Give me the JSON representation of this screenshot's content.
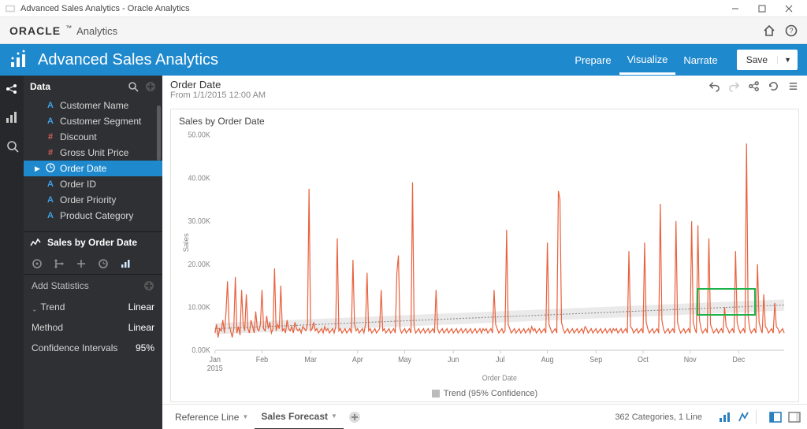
{
  "window": {
    "title": "Advanced Sales Analytics - Oracle Analytics"
  },
  "brand": {
    "oracle": "ORACLE",
    "tm": "™",
    "product": "Analytics"
  },
  "workbook": {
    "title": "Advanced Sales Analytics",
    "tabs": {
      "prepare": "Prepare",
      "visualize": "Visualize",
      "narrate": "Narrate"
    },
    "save_label": "Save"
  },
  "sidebar": {
    "data_header": "Data",
    "fields": [
      {
        "type": "A",
        "label": "Customer Name"
      },
      {
        "type": "A",
        "label": "Customer Segment"
      },
      {
        "type": "hash",
        "label": "Discount"
      },
      {
        "type": "hash",
        "label": "Gross Unit Price"
      },
      {
        "type": "clock",
        "label": "Order Date",
        "selected": true
      },
      {
        "type": "A",
        "label": "Order ID"
      },
      {
        "type": "A",
        "label": "Order Priority"
      },
      {
        "type": "A",
        "label": "Product Category"
      }
    ],
    "viz_name": "Sales by Order Date",
    "add_stats_label": "Add Statistics",
    "trend": {
      "label": "Trend",
      "value": "Linear"
    },
    "method": {
      "label": "Method",
      "value": "Linear"
    },
    "ci": {
      "label": "Confidence Intervals",
      "value": "95%"
    }
  },
  "canvas": {
    "breadcrumb_title": "Order Date",
    "breadcrumb_sub": "From 1/1/2015 12:00 AM",
    "chart_title": "Sales by Order Date",
    "y_axis_title": "Sales",
    "x_axis_title": "Order Date",
    "legend": "Trend (95% Confidence)",
    "y_ticks": [
      "0.00K",
      "10.00K",
      "20.00K",
      "30.00K",
      "40.00K",
      "50.00K"
    ],
    "x_ticks": [
      "Jan",
      "Feb",
      "Mar",
      "Apr",
      "May",
      "Jun",
      "Jul",
      "Aug",
      "Sep",
      "Oct",
      "Nov",
      "Dec"
    ],
    "x_tick_year": "2015"
  },
  "footer": {
    "tab1": "Reference Line",
    "tab2": "Sales Forecast",
    "status": "362 Categories, 1 Line"
  },
  "colors": {
    "accent": "#1f89ce",
    "series": "#e8603c",
    "trend_band": "#c9c9c9",
    "green_box": "#1fb24a"
  },
  "chart_data": {
    "type": "line",
    "title": "Sales by Order Date",
    "xlabel": "Order Date",
    "ylabel": "Sales",
    "ylim": [
      0,
      50000
    ],
    "x_range": [
      "2015-01-01",
      "2015-12-31"
    ],
    "x_tick_labels": [
      "Jan 2015",
      "Feb",
      "Mar",
      "Apr",
      "May",
      "Jun",
      "Jul",
      "Aug",
      "Sep",
      "Oct",
      "Nov",
      "Dec"
    ],
    "series": [
      {
        "name": "Sales",
        "color": "#e8603c",
        "note": "Daily sales totals for 2015 (362 categories). Values estimated from plot; index 0..361.",
        "values": [
          4000,
          6000,
          3000,
          5000,
          4500,
          7000,
          4000,
          8500,
          16000,
          6000,
          4500,
          3000,
          5000,
          17000,
          4000,
          5500,
          3500,
          14000,
          6000,
          4500,
          13000,
          5000,
          4000,
          7000,
          5500,
          4000,
          9000,
          5000,
          4500,
          6000,
          14000,
          5000,
          4500,
          8000,
          5000,
          6500,
          4000,
          5000,
          19000,
          4500,
          6000,
          5000,
          15000,
          4500,
          5000,
          4000,
          7000,
          5000,
          4500,
          5500,
          4000,
          6500,
          5000,
          4500,
          5000,
          4000,
          5500,
          5000,
          4500,
          6000,
          37500,
          4500,
          5000,
          6500,
          4500,
          5000,
          4000,
          4500,
          5000,
          4000,
          5500,
          4500,
          5000,
          4000,
          4500,
          5000,
          4000,
          5500,
          26000,
          4500,
          5000,
          4000,
          4500,
          5000,
          4000,
          4500,
          5000,
          4000,
          21000,
          6000,
          4500,
          5000,
          4000,
          4500,
          5000,
          4000,
          6000,
          18000,
          4500,
          5000,
          4000,
          4500,
          5000,
          4000,
          4500,
          5000,
          14000,
          4500,
          5000,
          4000,
          4500,
          5000,
          4000,
          4500,
          5000,
          4000,
          18000,
          22000,
          5000,
          4000,
          4500,
          5000,
          4000,
          4500,
          5000,
          4000,
          39000,
          5500,
          4000,
          4500,
          5000,
          4000,
          4500,
          5000,
          4000,
          4500,
          5000,
          4000,
          4500,
          5000,
          4000,
          14000,
          5000,
          4000,
          4500,
          5000,
          4000,
          4500,
          5000,
          4000,
          4500,
          5000,
          4000,
          4500,
          5000,
          4000,
          4500,
          5000,
          4000,
          4500,
          5000,
          4000,
          4500,
          5000,
          4000,
          4500,
          5000,
          4000,
          4500,
          5000,
          4000,
          5000,
          4500,
          5000,
          4000,
          4500,
          5000,
          4000,
          14000,
          6000,
          5000,
          4000,
          4500,
          5000,
          4000,
          4500,
          28000,
          6000,
          5000,
          4000,
          4500,
          5000,
          4000,
          4500,
          5000,
          4000,
          4500,
          5000,
          4000,
          4500,
          5000,
          4000,
          5500,
          4500,
          5000,
          4000,
          4500,
          5000,
          4000,
          4500,
          5000,
          4000,
          25000,
          6000,
          5000,
          4000,
          4500,
          5000,
          4000,
          37000,
          35000,
          6500,
          5000,
          4000,
          4500,
          5000,
          4000,
          4500,
          5000,
          4000,
          4500,
          5000,
          4000,
          4500,
          5000,
          4000,
          5500,
          5000,
          4000,
          4500,
          5000,
          4000,
          4500,
          5000,
          4000,
          4500,
          5000,
          4000,
          4500,
          5000,
          4000,
          4500,
          5000,
          4000,
          5000,
          4500,
          5000,
          4000,
          4500,
          5000,
          4000,
          4500,
          5000,
          4000,
          23000,
          5500,
          5000,
          4000,
          4500,
          5000,
          4000,
          4500,
          5000,
          4000,
          25000,
          6500,
          5000,
          4000,
          4500,
          5000,
          4000,
          4500,
          5000,
          4000,
          34000,
          7000,
          5000,
          4000,
          4500,
          5000,
          4000,
          4500,
          5000,
          4000,
          30000,
          6500,
          5000,
          4000,
          4500,
          5000,
          4000,
          4500,
          5000,
          4000,
          30000,
          6500,
          5000,
          4000,
          29000,
          7000,
          5000,
          4000,
          4500,
          5000,
          4000,
          26000,
          6000,
          5000,
          4000,
          4500,
          5000,
          4000,
          4500,
          5000,
          4000,
          10000,
          5500,
          5000,
          4000,
          4500,
          5000,
          4000,
          23000,
          6500,
          5000,
          4000,
          4500,
          5000,
          4000,
          48000,
          8000,
          5000,
          4000,
          4500,
          5000,
          4000,
          20000,
          6500,
          5000,
          4000,
          13000,
          5500,
          5000,
          4000,
          4500,
          5000,
          4000,
          11000,
          5500,
          5000,
          4000,
          4500,
          5000,
          4000
        ]
      }
    ],
    "trend": {
      "type": "linear",
      "start_value": 5000,
      "end_value": 10500,
      "confidence": 0.95,
      "band_halfwidth": 1300
    },
    "legend": [
      "Trend (95% Confidence)"
    ],
    "annotations": [
      {
        "type": "selection-rect",
        "color": "#1fb24a",
        "x_range_index": [
          307,
          345
        ],
        "y_range": [
          8000,
          14500
        ]
      }
    ],
    "status_summary": "362 Categories, 1 Line"
  }
}
